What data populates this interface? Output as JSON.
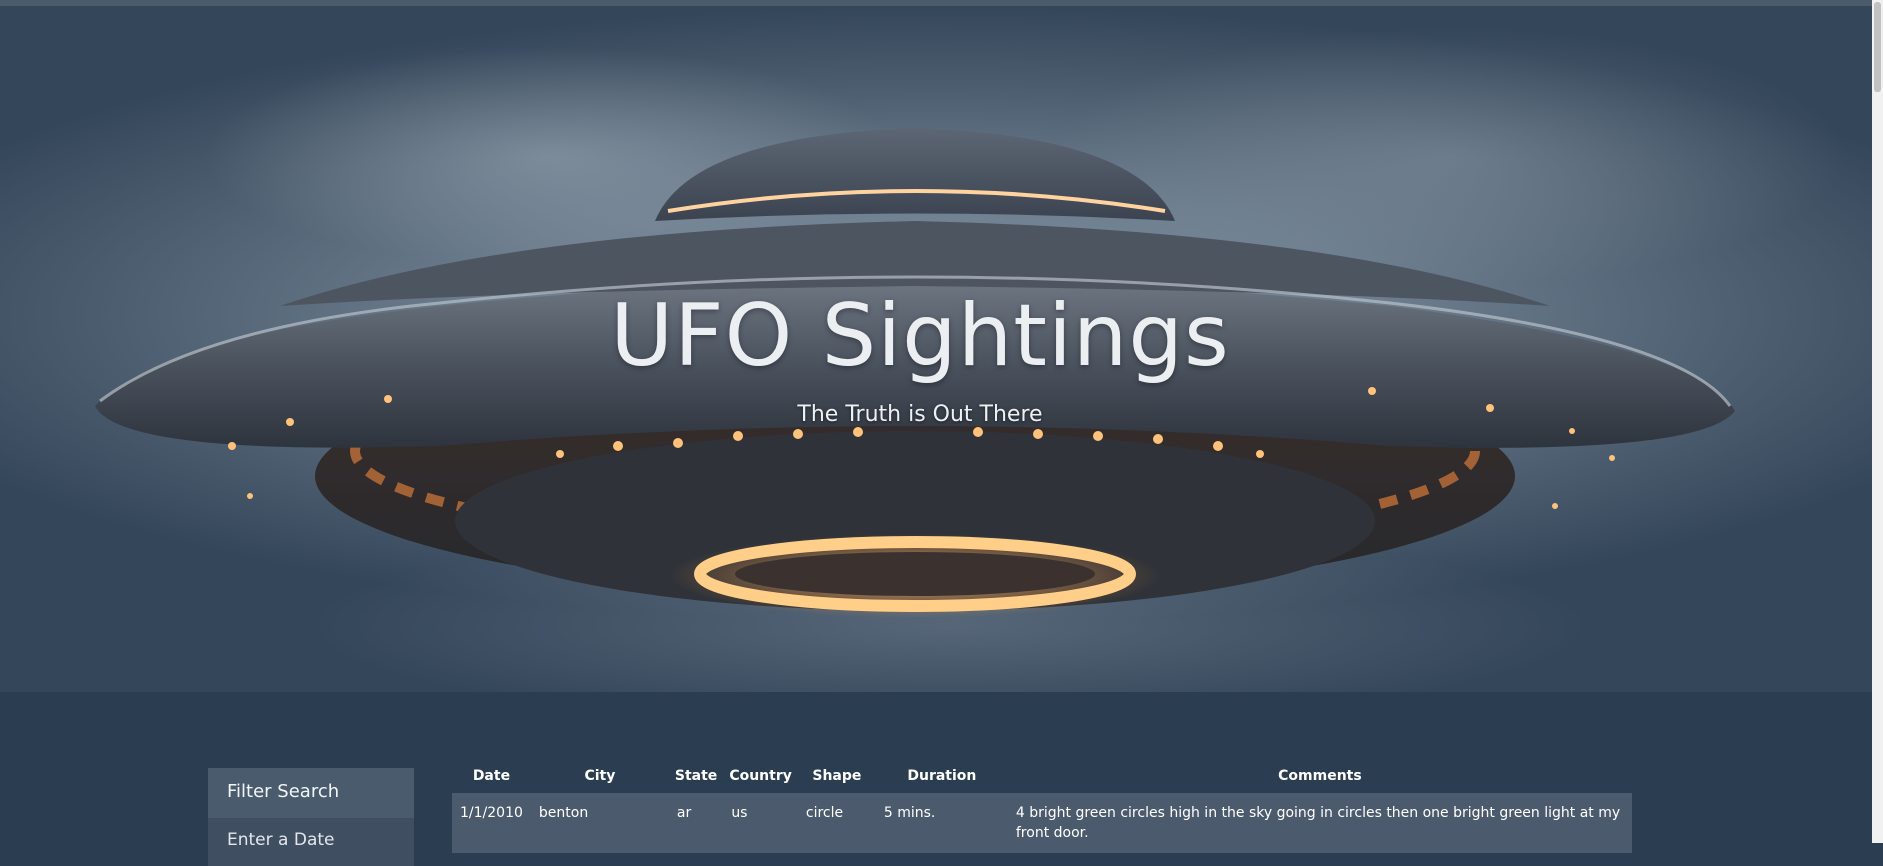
{
  "hero": {
    "title": "UFO Sightings",
    "subtitle": "The Truth is Out There"
  },
  "sidebar": {
    "heading": "Filter Search",
    "items": [
      {
        "label": "Enter a Date"
      }
    ]
  },
  "table": {
    "headers": [
      "Date",
      "City",
      "State",
      "Country",
      "Shape",
      "Duration",
      "Comments"
    ],
    "rows": [
      {
        "date": "1/1/2010",
        "city": "benton",
        "state": "ar",
        "country": "us",
        "shape": "circle",
        "duration": "5 mins.",
        "comments": "4 bright green circles high in the sky going in circles then one bright green light at my front door."
      }
    ]
  },
  "colors": {
    "page_bg": "#2b3d50",
    "sidebar_head": "#4a5b6e",
    "row_bg": "#4b5a6c",
    "text": "#ffffff"
  }
}
